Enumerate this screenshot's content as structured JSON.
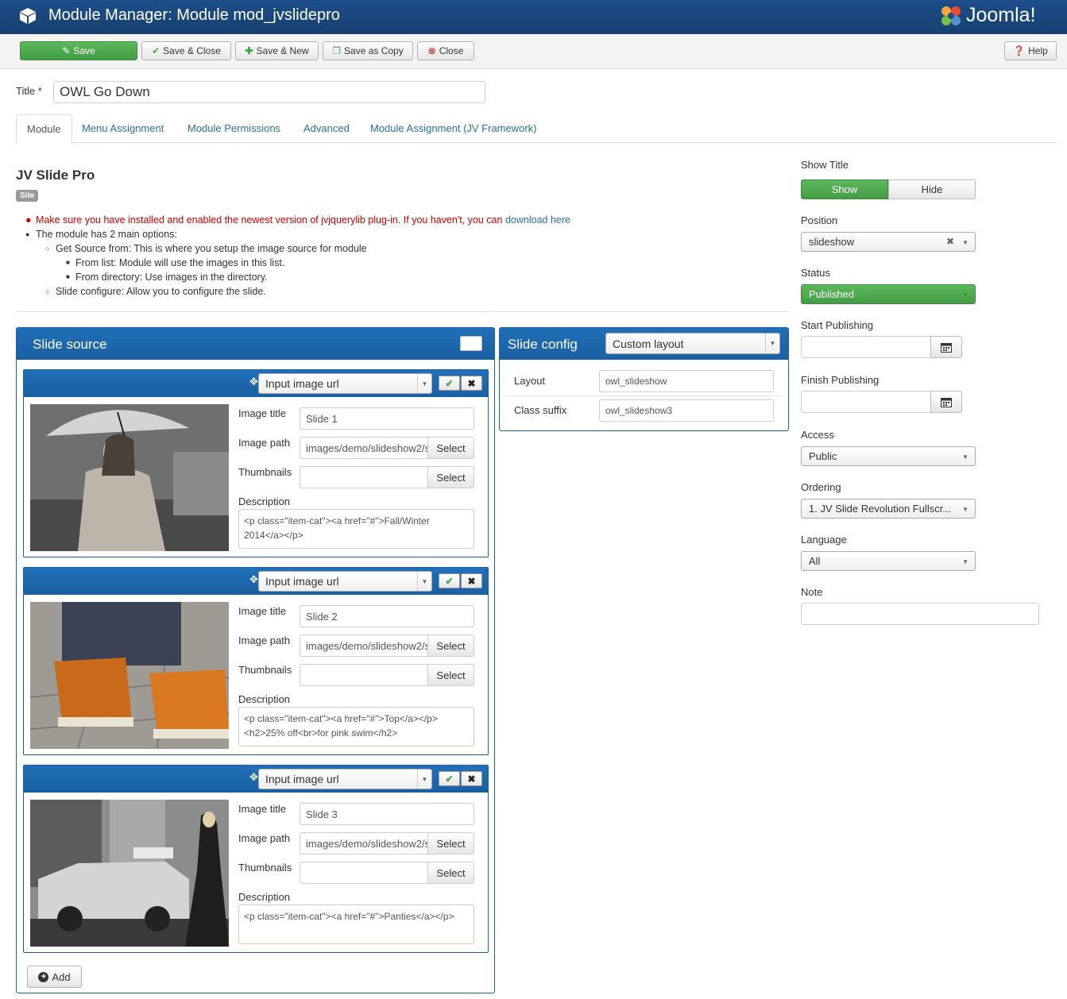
{
  "header": {
    "title": "Module Manager: Module mod_jvslidepro",
    "logo_text": "Joomla!"
  },
  "toolbar": {
    "save": "Save",
    "save_close": "Save & Close",
    "save_new": "Save & New",
    "save_copy": "Save as Copy",
    "close": "Close",
    "help": "Help"
  },
  "form": {
    "title_label": "Title",
    "title_required": "*",
    "title_value": "OWL Go Down"
  },
  "tabs": [
    "Module",
    "Menu Assignment",
    "Module Permissions",
    "Advanced",
    "Module Assignment (JV Framework)"
  ],
  "module": {
    "name": "JV Slide Pro",
    "badge": "Site",
    "info": {
      "warning": "Make sure you have installed and enabled the newest version of jvjquerylib plug-in. If you haven't, you can",
      "download_link": "download here",
      "main": "The module has 2 main options:",
      "source": "Get Source from: This is where you setup the image source for module",
      "from_list": "From list: Module will use the images in this list.",
      "from_dir": "From directory: Use images in the directory.",
      "configure": "Slide configure: Allow you to configure the slide."
    }
  },
  "slide_source": {
    "title": "Slide source",
    "labels": {
      "image_title": "Image title",
      "image_path": "Image path",
      "thumbnails": "Thumbnails",
      "description": "Description",
      "select": "Select"
    },
    "slides": [
      {
        "type": "Input image url",
        "title": "Slide 1",
        "path": "images/demo/slideshow2/s",
        "thumbnail": "",
        "description": "<p class=\"item-cat\"><a href=\"#\">Fall/Winter 2014</a></p>"
      },
      {
        "type": "Input image url",
        "title": "Slide 2",
        "path": "images/demo/slideshow2/s",
        "thumbnail": "",
        "description": "<p class=\"item-cat\"><a href=\"#\">Top</a></p><h2>25% off<br>for pink swim</h2>"
      },
      {
        "type": "Input image url",
        "title": "Slide 3",
        "path": "images/demo/slideshow2/s",
        "thumbnail": "",
        "description": "<p class=\"item-cat\"><a href=\"#\">Panties</a></p>"
      }
    ],
    "add": "Add"
  },
  "slide_config": {
    "title": "Slide config",
    "layout_select": "Custom layout",
    "layout_label": "Layout",
    "layout_value": "owl_slideshow",
    "suffix_label": "Class suffix",
    "suffix_value": "owl_slideshow3"
  },
  "sidebar": {
    "show_title_label": "Show Title",
    "show": "Show",
    "hide": "Hide",
    "position_label": "Position",
    "position_value": "slideshow",
    "status_label": "Status",
    "status_value": "Published",
    "start_label": "Start Publishing",
    "start_value": "",
    "finish_label": "Finish Publishing",
    "finish_value": "",
    "access_label": "Access",
    "access_value": "Public",
    "ordering_label": "Ordering",
    "ordering_value": "1. JV Slide Revolution Fullscr...",
    "language_label": "Language",
    "language_value": "All",
    "note_label": "Note",
    "note_value": ""
  },
  "colors": {
    "header": "#1d4f8a",
    "save_green": "#5cb85c",
    "link": "#2a6ea6",
    "warning": "#d00000"
  }
}
